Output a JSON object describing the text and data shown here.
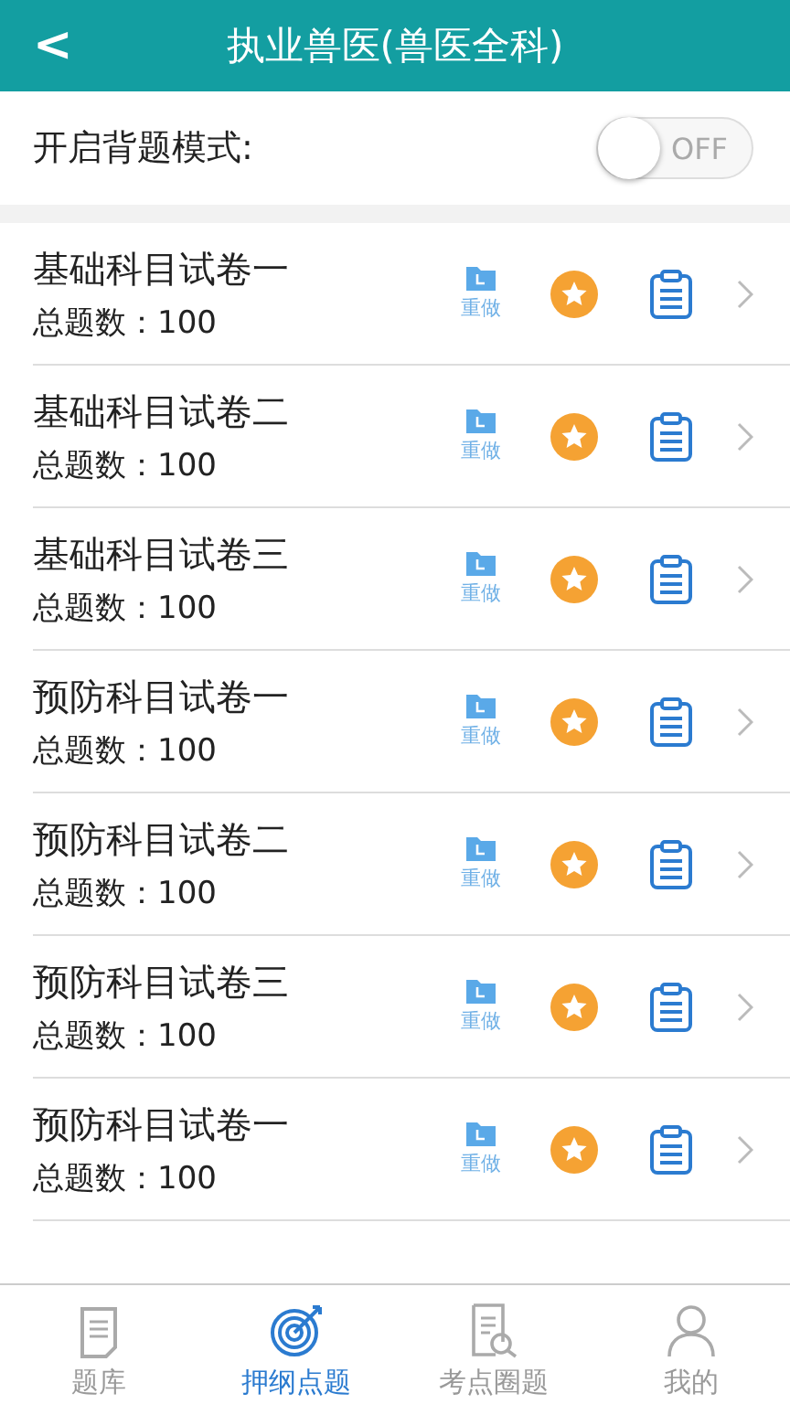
{
  "header": {
    "back": "<",
    "title": "执业兽医(兽医全科)"
  },
  "memorize_mode": {
    "label": "开启背题模式:",
    "on": false,
    "state_text": "OFF"
  },
  "papers": [
    {
      "title": "基础科目试卷一",
      "count": "总题数：100",
      "redo": "重做"
    },
    {
      "title": "基础科目试卷二",
      "count": "总题数：100",
      "redo": "重做"
    },
    {
      "title": "基础科目试卷三",
      "count": "总题数：100",
      "redo": "重做"
    },
    {
      "title": "预防科目试卷一",
      "count": "总题数：100",
      "redo": "重做"
    },
    {
      "title": "预防科目试卷二",
      "count": "总题数：100",
      "redo": "重做"
    },
    {
      "title": "预防科目试卷三",
      "count": "总题数：100",
      "redo": "重做"
    },
    {
      "title": "预防科目试卷一",
      "count": "总题数：100",
      "redo": "重做"
    }
  ],
  "tabs": [
    {
      "label": "题库",
      "kind": "document",
      "selected": false
    },
    {
      "label": "押纲点题",
      "kind": "target",
      "selected": true
    },
    {
      "label": "考点圈题",
      "kind": "search",
      "selected": false
    },
    {
      "label": "我的",
      "kind": "person",
      "selected": false
    }
  ]
}
